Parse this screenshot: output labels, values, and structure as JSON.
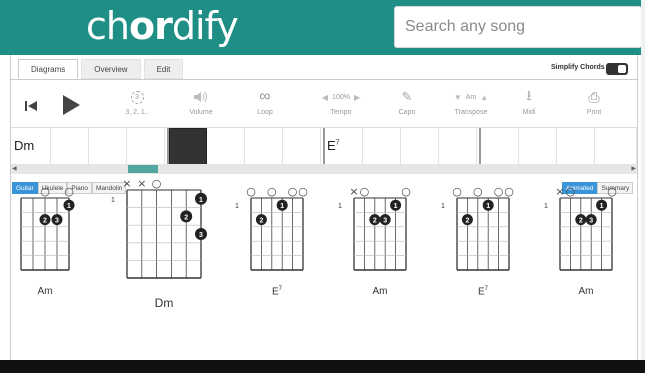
{
  "header": {
    "logo_pre": "ch",
    "logo_bold": "or",
    "logo_post": "dify",
    "search_placeholder": "Search any song"
  },
  "tabs": [
    {
      "label": "Diagrams",
      "active": true
    },
    {
      "label": "Overview",
      "active": false
    },
    {
      "label": "Edit",
      "active": false
    }
  ],
  "simplify_label": "Simplify Chords",
  "controls": [
    {
      "icon": "countdown-icon",
      "glyph": "3",
      "label": "3, 2, 1.."
    },
    {
      "icon": "volume-icon",
      "glyph": "🔊",
      "label": "Volume"
    },
    {
      "icon": "loop-icon",
      "glyph": "∞",
      "label": "Loop"
    },
    {
      "icon": "tempo-icon",
      "glyph": "100%",
      "label": "Tempo"
    },
    {
      "icon": "capo-icon",
      "glyph": "✎",
      "label": "Capo"
    },
    {
      "icon": "transpose-icon",
      "glyph": "Am",
      "label": "Transpose"
    },
    {
      "icon": "midi-icon",
      "glyph": "⭳",
      "label": "Midi"
    },
    {
      "icon": "print-icon",
      "glyph": "⎙",
      "label": "Print"
    }
  ],
  "timeline": {
    "chords": [
      {
        "label": "Dm",
        "sup": ""
      },
      {
        "label": "E",
        "sup": "7"
      }
    ]
  },
  "instruments": [
    {
      "label": "Guitar",
      "active": true
    },
    {
      "label": "Ukulele",
      "active": false
    },
    {
      "label": "Piano",
      "active": false
    },
    {
      "label": "Mandolin",
      "active": false
    }
  ],
  "modes": [
    {
      "label": "Animated",
      "active": true
    },
    {
      "label": "Summary",
      "active": false
    }
  ],
  "diagrams": [
    {
      "name": "Am",
      "sup": "",
      "fret": "1",
      "top": "○ ○ ○",
      "fingers": [
        "2",
        "3",
        "1"
      ]
    },
    {
      "name": "Dm",
      "sup": "",
      "fret": "1",
      "top": "✕✕○",
      "fingers": [
        "1",
        "2",
        "3"
      ]
    },
    {
      "name": "E",
      "sup": "7",
      "fret": "1",
      "top": "○ ○ ○○",
      "fingers": [
        "2",
        "1"
      ]
    },
    {
      "name": "Am",
      "sup": "",
      "fret": "1",
      "top": "✕○ ○",
      "fingers": [
        "2",
        "3",
        "1"
      ]
    },
    {
      "name": "E",
      "sup": "7",
      "fret": "1",
      "top": "○ ○ ○○",
      "fingers": [
        "2",
        "1"
      ]
    },
    {
      "name": "Am",
      "sup": "",
      "fret": "1",
      "top": "✕○ ○",
      "fingers": [
        "2",
        "3",
        "1"
      ]
    }
  ]
}
